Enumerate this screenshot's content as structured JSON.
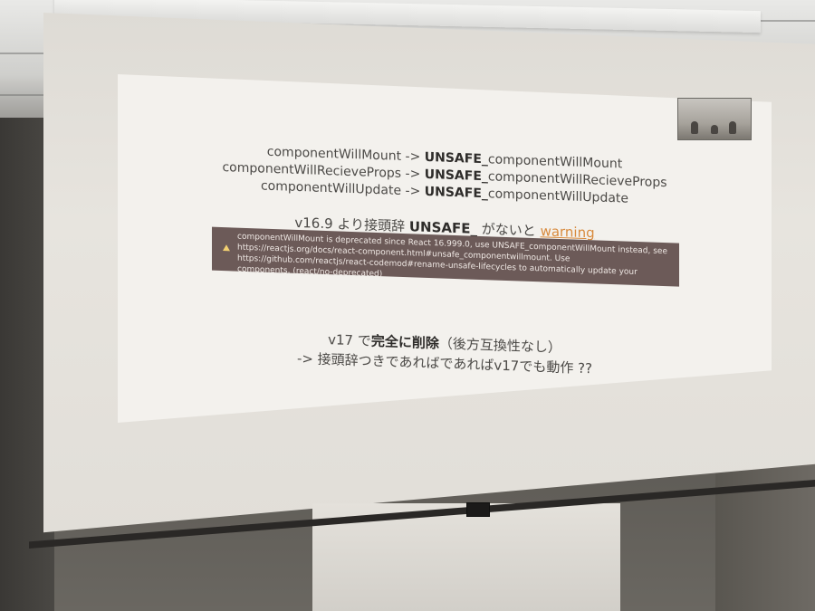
{
  "slide": {
    "lines": [
      {
        "pre": "componentWillMount -> ",
        "bold": "UNSAFE_",
        "post": "componentWillMount"
      },
      {
        "pre": "componentWillRecieveProps -> ",
        "bold": "UNSAFE_",
        "post": "componentWillRecieveProps"
      },
      {
        "pre": "componentWillUpdate -> ",
        "bold": "UNSAFE_",
        "post": "componentWillUpdate"
      }
    ],
    "version_line": {
      "pre": "v16.9 より接頭辞 ",
      "bold": "UNSAFE_",
      "mid": " がないと ",
      "link": "warning"
    },
    "warning_box": [
      "componentWillMount is deprecated since React 16.999.0, use UNSAFE_componentWillMount instead, see",
      "https://reactjs.org/docs/react-component.html#unsafe_componentwillmount. Use",
      "https://github.com/reactjs/react-codemod#rename-unsafe-lifecycles to automatically update your",
      "components. (react/no-deprecated)"
    ],
    "v17_line": {
      "pre": "v17 で",
      "bold": "完全に削除",
      "post": "（後方互換性なし）"
    },
    "last_line": "-> 接頭辞つきであればであればv17でも動作 ??"
  },
  "colors": {
    "slide_bg": "#f3f1ed",
    "text": "#4c4a47",
    "bold_text": "#2e2c2a",
    "warning_link": "#d88a3d",
    "warning_box_bg": "#6c5a58",
    "warning_icon": "#f2d071"
  }
}
